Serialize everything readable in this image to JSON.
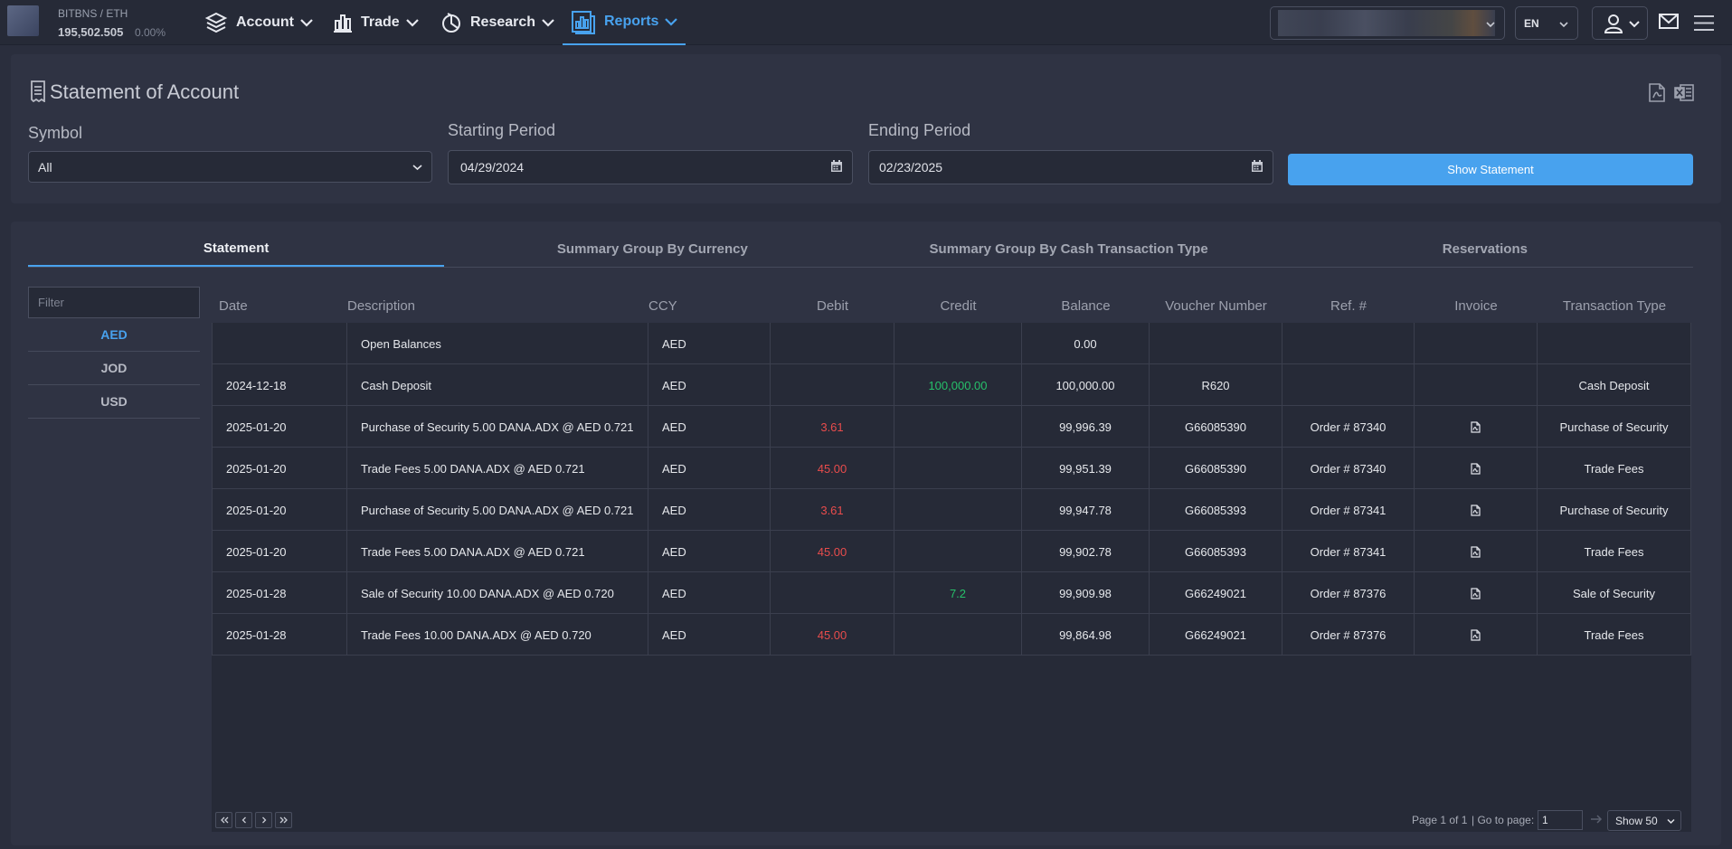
{
  "topbar": {
    "ticker_name": "BITBNS / ETH",
    "ticker_value": "195,502.505",
    "ticker_change": "0.00%",
    "nav": [
      {
        "label": "Account",
        "icon": "layers-icon"
      },
      {
        "label": "Trade",
        "icon": "bar-chart-icon"
      },
      {
        "label": "Research",
        "icon": "pie-chart-icon"
      },
      {
        "label": "Reports",
        "icon": "report-icon"
      }
    ],
    "language": "EN"
  },
  "page": {
    "title": "Statement of Account",
    "symbol_label": "Symbol",
    "symbol_value": "All",
    "start_label": "Starting Period",
    "start_value": "04/29/2024",
    "end_label": "Ending Period",
    "end_value": "02/23/2025",
    "show_button": "Show Statement"
  },
  "tabs": [
    "Statement",
    "Summary Group By Currency",
    "Summary Group By Cash Transaction Type",
    "Reservations"
  ],
  "filter": {
    "placeholder": "Filter",
    "currencies": [
      "AED",
      "JOD",
      "USD"
    ]
  },
  "table": {
    "headers": [
      "Date",
      "Description",
      "CCY",
      "Debit",
      "Credit",
      "Balance",
      "Voucher Number",
      "Ref. #",
      "Invoice",
      "Transaction Type"
    ],
    "rows": [
      {
        "date": "",
        "description": "Open Balances",
        "ccy": "AED",
        "debit": "",
        "credit": "",
        "balance": "0.00",
        "voucher": "",
        "ref": "",
        "invoice": false,
        "type": ""
      },
      {
        "date": "2024-12-18",
        "description": "Cash Deposit",
        "ccy": "AED",
        "debit": "",
        "credit": "100,000.00",
        "balance": "100,000.00",
        "voucher": "R620",
        "ref": "",
        "invoice": false,
        "type": "Cash Deposit"
      },
      {
        "date": "2025-01-20",
        "description": "Purchase of Security 5.00 DANA.ADX @ AED 0.721",
        "ccy": "AED",
        "debit": "3.61",
        "credit": "",
        "balance": "99,996.39",
        "voucher": "G66085390",
        "ref": "Order # 87340",
        "invoice": true,
        "type": "Purchase of Security"
      },
      {
        "date": "2025-01-20",
        "description": "Trade Fees 5.00 DANA.ADX @ AED 0.721",
        "ccy": "AED",
        "debit": "45.00",
        "credit": "",
        "balance": "99,951.39",
        "voucher": "G66085390",
        "ref": "Order # 87340",
        "invoice": true,
        "type": "Trade Fees"
      },
      {
        "date": "2025-01-20",
        "description": "Purchase of Security 5.00 DANA.ADX @ AED 0.721",
        "ccy": "AED",
        "debit": "3.61",
        "credit": "",
        "balance": "99,947.78",
        "voucher": "G66085393",
        "ref": "Order # 87341",
        "invoice": true,
        "type": "Purchase of Security"
      },
      {
        "date": "2025-01-20",
        "description": "Trade Fees 5.00 DANA.ADX @ AED 0.721",
        "ccy": "AED",
        "debit": "45.00",
        "credit": "",
        "balance": "99,902.78",
        "voucher": "G66085393",
        "ref": "Order # 87341",
        "invoice": true,
        "type": "Trade Fees"
      },
      {
        "date": "2025-01-28",
        "description": "Sale of Security 10.00 DANA.ADX @ AED 0.720",
        "ccy": "AED",
        "debit": "",
        "credit": "7.2",
        "balance": "99,909.98",
        "voucher": "G66249021",
        "ref": "Order # 87376",
        "invoice": true,
        "type": "Sale of Security"
      },
      {
        "date": "2025-01-28",
        "description": "Trade Fees 10.00 DANA.ADX @ AED 0.720",
        "ccy": "AED",
        "debit": "45.00",
        "credit": "",
        "balance": "99,864.98",
        "voucher": "G66249021",
        "ref": "Order # 87376",
        "invoice": true,
        "type": "Trade Fees"
      }
    ]
  },
  "pager": {
    "page_info": "Page 1 of 1",
    "goto_label": "| Go to page:",
    "goto_value": "1",
    "show_label": "Show 50"
  },
  "colors": {
    "accent": "#48a2ee",
    "debit": "#e84c4c",
    "credit": "#27c06a"
  }
}
